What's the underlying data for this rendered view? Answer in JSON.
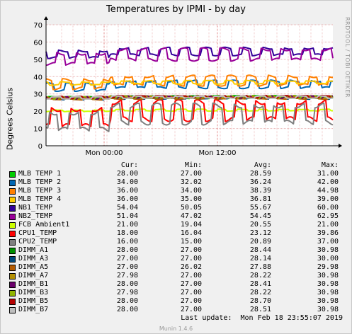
{
  "chart_data": {
    "type": "line",
    "title": "Temperatures by IPMI - by day",
    "ylabel": "Degrees Celsius",
    "ylim": [
      0,
      70
    ],
    "yticks": [
      0,
      10,
      20,
      30,
      40,
      50,
      60,
      70
    ],
    "xticks": [
      "Mon 00:00",
      "Mon 12:00"
    ],
    "grid": true,
    "vertical_text": "RRDTOOL / TOBI OETIKER",
    "legend_headers": [
      "Cur:",
      "Min:",
      "Avg:",
      "Max:"
    ],
    "series": [
      {
        "name": "MLB TEMP 1",
        "color": "#00cc00",
        "cur": "28.00",
        "min": "27.00",
        "avg": "28.59",
        "max": "31.00",
        "base": 28,
        "amp": 1.2
      },
      {
        "name": "MLB TEMP 2",
        "color": "#0066b3",
        "cur": "34.00",
        "min": "32.02",
        "avg": "36.24",
        "max": "42.00",
        "base": 35,
        "amp": 3.5
      },
      {
        "name": "MLB TEMP 3",
        "color": "#ff8000",
        "cur": "36.00",
        "min": "34.00",
        "avg": "38.39",
        "max": "44.98",
        "base": 37,
        "amp": 4.5
      },
      {
        "name": "MLB TEMP 4",
        "color": "#ffcc00",
        "cur": "36.00",
        "min": "35.00",
        "avg": "36.81",
        "max": "39.00",
        "base": 36.5,
        "amp": 1.5
      },
      {
        "name": "NB1_TEMP",
        "color": "#330099",
        "cur": "54.04",
        "min": "50.05",
        "avg": "55.67",
        "max": "60.00",
        "base": 54,
        "amp": 3.5
      },
      {
        "name": "NB2_TEMP",
        "color": "#990099",
        "cur": "51.04",
        "min": "47.02",
        "avg": "54.45",
        "max": "62.95",
        "base": 52,
        "amp": 5.5
      },
      {
        "name": "FCB Ambient1",
        "color": "#ccff00",
        "cur": "21.00",
        "min": "19.04",
        "avg": "20.55",
        "max": "21.00",
        "base": 20.5,
        "amp": 0.8
      },
      {
        "name": "CPU1_TEMP",
        "color": "#ff0000",
        "cur": "18.00",
        "min": "16.04",
        "avg": "23.12",
        "max": "39.86",
        "base": 19,
        "amp": 9
      },
      {
        "name": "CPU2_TEMP",
        "color": "#808080",
        "cur": "16.00",
        "min": "15.00",
        "avg": "20.89",
        "max": "37.00",
        "base": 17,
        "amp": 9
      },
      {
        "name": "DIMM_A1",
        "color": "#008f00",
        "cur": "28.00",
        "min": "27.00",
        "avg": "28.44",
        "max": "30.98",
        "base": 28,
        "amp": 1
      },
      {
        "name": "DIMM_A3",
        "color": "#00487d",
        "cur": "27.00",
        "min": "27.00",
        "avg": "28.14",
        "max": "30.00",
        "base": 27.5,
        "amp": 1
      },
      {
        "name": "DIMM_A5",
        "color": "#b35a00",
        "cur": "27.00",
        "min": "26.02",
        "avg": "27.88",
        "max": "29.98",
        "base": 27.5,
        "amp": 1
      },
      {
        "name": "DIMM_A7",
        "color": "#b38f00",
        "cur": "27.98",
        "min": "27.00",
        "avg": "28.22",
        "max": "30.98",
        "base": 28,
        "amp": 1
      },
      {
        "name": "DIMM_B1",
        "color": "#6b006b",
        "cur": "28.00",
        "min": "27.00",
        "avg": "28.41",
        "max": "30.98",
        "base": 28,
        "amp": 1
      },
      {
        "name": "DIMM_B3",
        "color": "#8fb300",
        "cur": "27.98",
        "min": "27.00",
        "avg": "28.22",
        "max": "30.98",
        "base": 28,
        "amp": 1
      },
      {
        "name": "DIMM_B5",
        "color": "#b30000",
        "cur": "28.00",
        "min": "27.00",
        "avg": "28.70",
        "max": "30.98",
        "base": 28.2,
        "amp": 1
      },
      {
        "name": "DIMM_B7",
        "color": "#bebebe",
        "cur": "28.00",
        "min": "27.00",
        "avg": "28.51",
        "max": "30.98",
        "base": 28,
        "amp": 1
      }
    ]
  },
  "footer": {
    "last_update": "Last update:  Mon Feb 18 23:55:07 2019",
    "generator": "Munin 1.4.6"
  }
}
